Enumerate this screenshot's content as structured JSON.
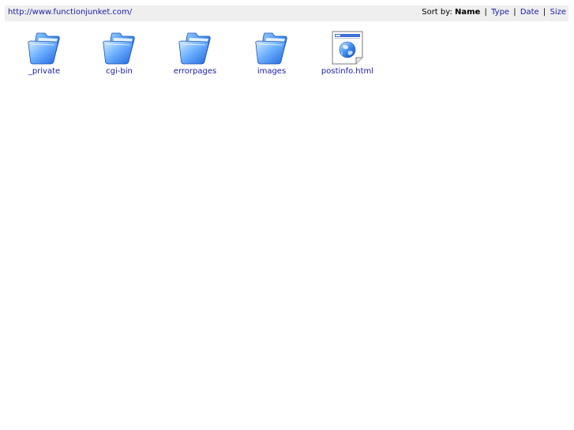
{
  "header": {
    "url": "http://www.functionjunket.com/",
    "sort_prefix": "Sort by:",
    "sort_options": [
      {
        "label": "Name",
        "active": true
      },
      {
        "label": "Type",
        "active": false
      },
      {
        "label": "Date",
        "active": false
      },
      {
        "label": "Size",
        "active": false
      }
    ],
    "separator": "|"
  },
  "items": [
    {
      "label": "_private",
      "icon": "folder-icon"
    },
    {
      "label": "cgi-bin",
      "icon": "folder-icon"
    },
    {
      "label": "errorpages",
      "icon": "folder-icon"
    },
    {
      "label": "images",
      "icon": "folder-icon"
    },
    {
      "label": "postinfo.html",
      "icon": "html-file-icon"
    }
  ],
  "colors": {
    "link": "#1a1aa6",
    "bar_background": "#efefef",
    "folder_blue": "#2f7fe8"
  }
}
